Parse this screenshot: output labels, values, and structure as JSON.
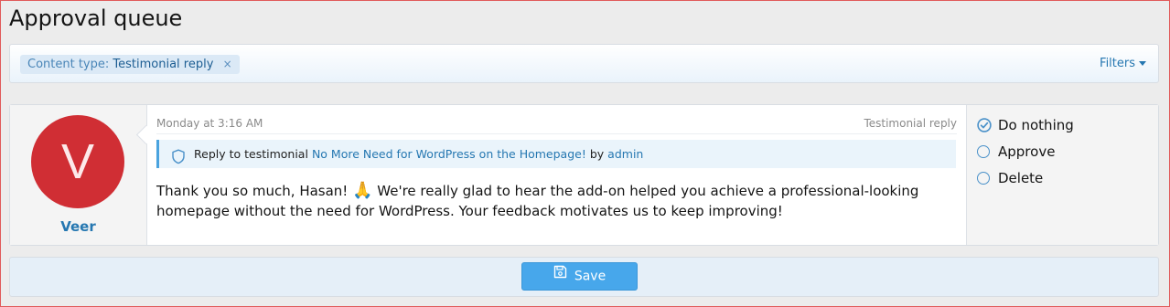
{
  "page": {
    "title": "Approval queue"
  },
  "filters": {
    "active_key": "Content type:",
    "active_value": "Testimonial reply",
    "remove_glyph": "×",
    "menu_label": "Filters",
    "menu_icon": "caret-down-icon"
  },
  "item": {
    "user": {
      "name": "Veer",
      "avatar_letter": "V",
      "avatar_color": "#d02e34"
    },
    "date": "Monday at 3:16 AM",
    "content_type": "Testimonial reply",
    "reply": {
      "icon": "shield-icon",
      "prefix": "Reply to testimonial",
      "title": "No More Need for WordPress on the Homepage!",
      "by": "by",
      "author": "admin"
    },
    "body_before_emoji": "Thank you so much, Hasan! ",
    "emoji": "🙏",
    "body_after_emoji": " We're really glad to hear the add-on helped you achieve a professional-looking homepage without the need for WordPress. Your feedback motivates us to keep improving!"
  },
  "actions": {
    "options": [
      {
        "label": "Do nothing",
        "selected": true
      },
      {
        "label": "Approve",
        "selected": false
      },
      {
        "label": "Delete",
        "selected": false
      }
    ]
  },
  "save": {
    "label": "Save",
    "icon": "floppy-disk-icon"
  },
  "colors": {
    "accent": "#2577b1",
    "button": "#47a7eb",
    "avatar": "#d02e34"
  }
}
